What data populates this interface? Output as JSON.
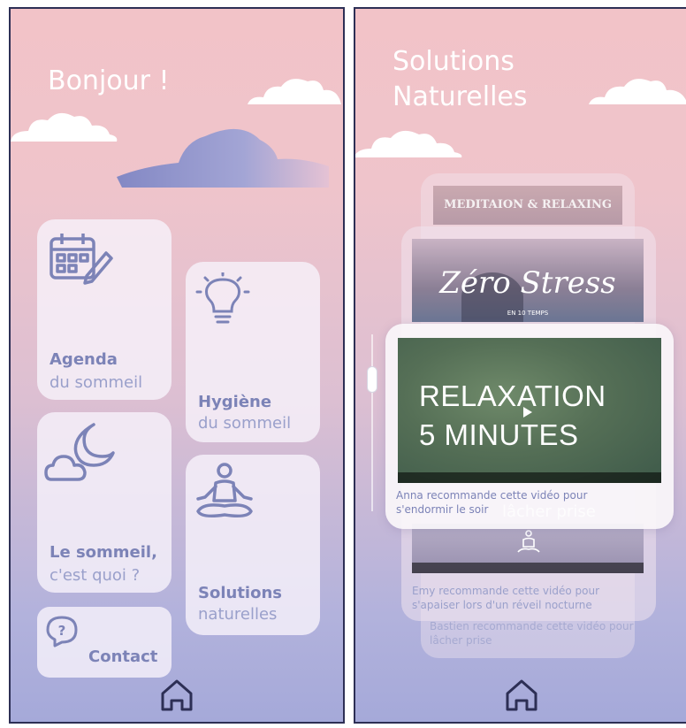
{
  "left": {
    "greeting": "Bonjour !",
    "tiles": [
      {
        "title": "Agenda",
        "subtitle": "du sommeil",
        "icon": "calendar-edit-icon"
      },
      {
        "title": "Hygiène",
        "subtitle": "du sommeil",
        "icon": "lightbulb-icon"
      },
      {
        "title": "Le sommeil,",
        "subtitle": "c'est quoi ?",
        "icon": "cloud-moon-icon"
      },
      {
        "title": "Solutions",
        "subtitle": "naturelles",
        "icon": "meditation-icon"
      },
      {
        "label": "Contact",
        "icon": "question-bubble-icon"
      }
    ],
    "home_icon": "home-icon"
  },
  "right": {
    "title_line1": "Solutions",
    "title_line2": "Naturelles",
    "videos": [
      {
        "thumb_text": "MEDITAION & RELAXING",
        "caption_line1": "Bastien recommande cette vidéo pour",
        "caption_line2": "lâcher prise"
      },
      {
        "thumb_text": "Zéro Stress",
        "thumb_subtext": "EN 10 TEMPS",
        "caption_line1": "Emy recommande cette vidéo pour",
        "caption_line2": "s'apaiser lors d'un réveil nocturne"
      },
      {
        "thumb_line1": "RELAXATION",
        "thumb_line2": "5 MINUTES",
        "caption_line1": "Anna recommande cette vidéo pour",
        "caption_line2": "s'endormir le soir",
        "overlay_text": "lâcher prise"
      }
    ],
    "scroll_position": 0.25,
    "home_icon": "home-icon"
  }
}
